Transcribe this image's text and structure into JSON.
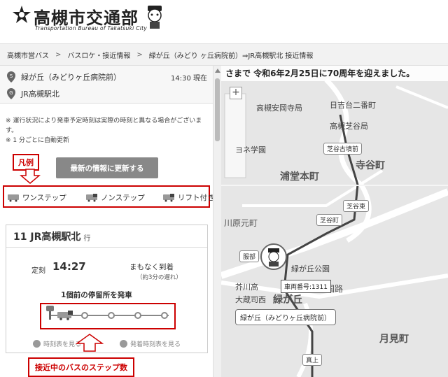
{
  "header": {
    "title": "高槻市交通部",
    "subtitle": "Transportation Bureau of Takatsuki City"
  },
  "breadcrumb": [
    "高槻市営バス",
    "バスロケ・接近情報",
    "緑が丘（みどり ヶ丘病院前）⇒JR高槻駅北 接近情報"
  ],
  "stops": {
    "from": "緑が丘（みどりヶ丘病院前）",
    "to": "JR高槻駅北",
    "time_now": "14:30 現在"
  },
  "notes": [
    "※ 運行状況により発車予定時刻は実際の時刻と異なる場合がございます。",
    "※ 1 分ごとに自動更新"
  ],
  "legend_label": "凡例",
  "update_button": "最新の情報に更新する",
  "legend_items": [
    "ワンステップ",
    "ノンステップ",
    "リフト付き"
  ],
  "card": {
    "route": "11 JR高槻駅北",
    "route_suffix": "行",
    "scheduled_label": "定刻",
    "scheduled_time": "14:27",
    "arriving": "まもなく到着",
    "delay": "（約3分の遅れ）",
    "prev_stop": "1個前の停留所を発車",
    "link_timetable": "時刻表を見る",
    "link_departure": "発着時刻表を見る"
  },
  "step_label": "接近中のバスのステップ数",
  "map": {
    "ticker": "さまで 令和6年2月25日に70周年を迎えました。",
    "places_big": [
      "浦堂本町",
      "寺谷町",
      "月見町"
    ],
    "places": [
      "日吉台二番町",
      "高槻安岡寺局",
      "高槻芝谷局",
      "ヨネ学園",
      "川原元町",
      "芥川高",
      "大蔵司西",
      "国路",
      "緑が丘公園"
    ],
    "tags": [
      "芝谷古墳前",
      "芝谷東",
      "芝谷町",
      "服部",
      "真上"
    ],
    "vehicle": "車両番号:1311",
    "stop_name": "緑が丘（みどりヶ丘病院前）",
    "area": "緑が丘"
  },
  "colors": {
    "accent": "#cc0000",
    "button": "#888888"
  }
}
